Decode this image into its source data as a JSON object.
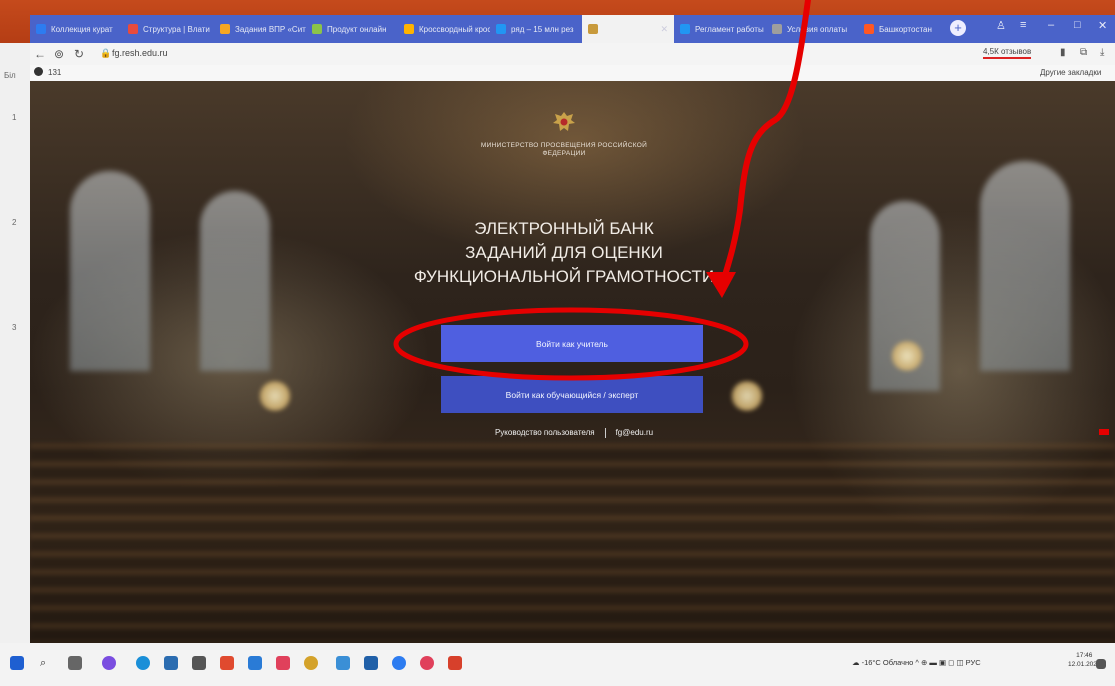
{
  "browser": {
    "tabs": [
      {
        "label": "Коллекция курат",
        "color": "#2d7cf0"
      },
      {
        "label": "Структура | Влати",
        "color": "#e94b3c"
      },
      {
        "label": "Задания ВПР «Сит",
        "color": "#f5a623"
      },
      {
        "label": "Продукт онлайн",
        "color": "#8bc34a"
      },
      {
        "label": "Кроссвордный кросс",
        "color": "#ffb300"
      },
      {
        "label": "ряд – 15 млн рез",
        "color": "#2196f3"
      },
      {
        "label": "",
        "color": "#c89a3c"
      },
      {
        "label": "Регламент работы",
        "color": "#2196f3"
      },
      {
        "label": "Условия оплаты",
        "color": "#9e9e9e"
      },
      {
        "label": "Башкортостан",
        "color": "#ff5722"
      }
    ],
    "url": "fg.resh.edu.ru",
    "reviews": "4,5К отзывов",
    "bookmarks_right": "Другие закладки",
    "bookmark_left": "131",
    "left_labels": [
      "Біл",
      "1",
      "2",
      "3"
    ]
  },
  "hero": {
    "ministry": "МИНИСТЕРСТВО ПРОСВЕЩЕНИЯ РОССИЙСКОЙ ФЕДЕРАЦИИ",
    "title_line1": "ЭЛЕКТРОННЫЙ БАНК",
    "title_line2": "ЗАДАНИЙ ДЛЯ ОЦЕНКИ",
    "title_line3": "ФУНКЦИОНАЛЬНОЙ ГРАМОТНОСТИ",
    "btn_teacher": "Войти как учитель",
    "btn_student": "Войти как обучающийся / эксперт",
    "link_guide": "Руководство пользователя",
    "link_email": "fg@edu.ru"
  },
  "taskbar": {
    "weather": "-16°C Облачно",
    "lang": "РУС",
    "time": "17:46",
    "date": "12.01.2022"
  },
  "colors": {
    "annotation": "#e60000",
    "primary_button": "#4f5fe0"
  }
}
